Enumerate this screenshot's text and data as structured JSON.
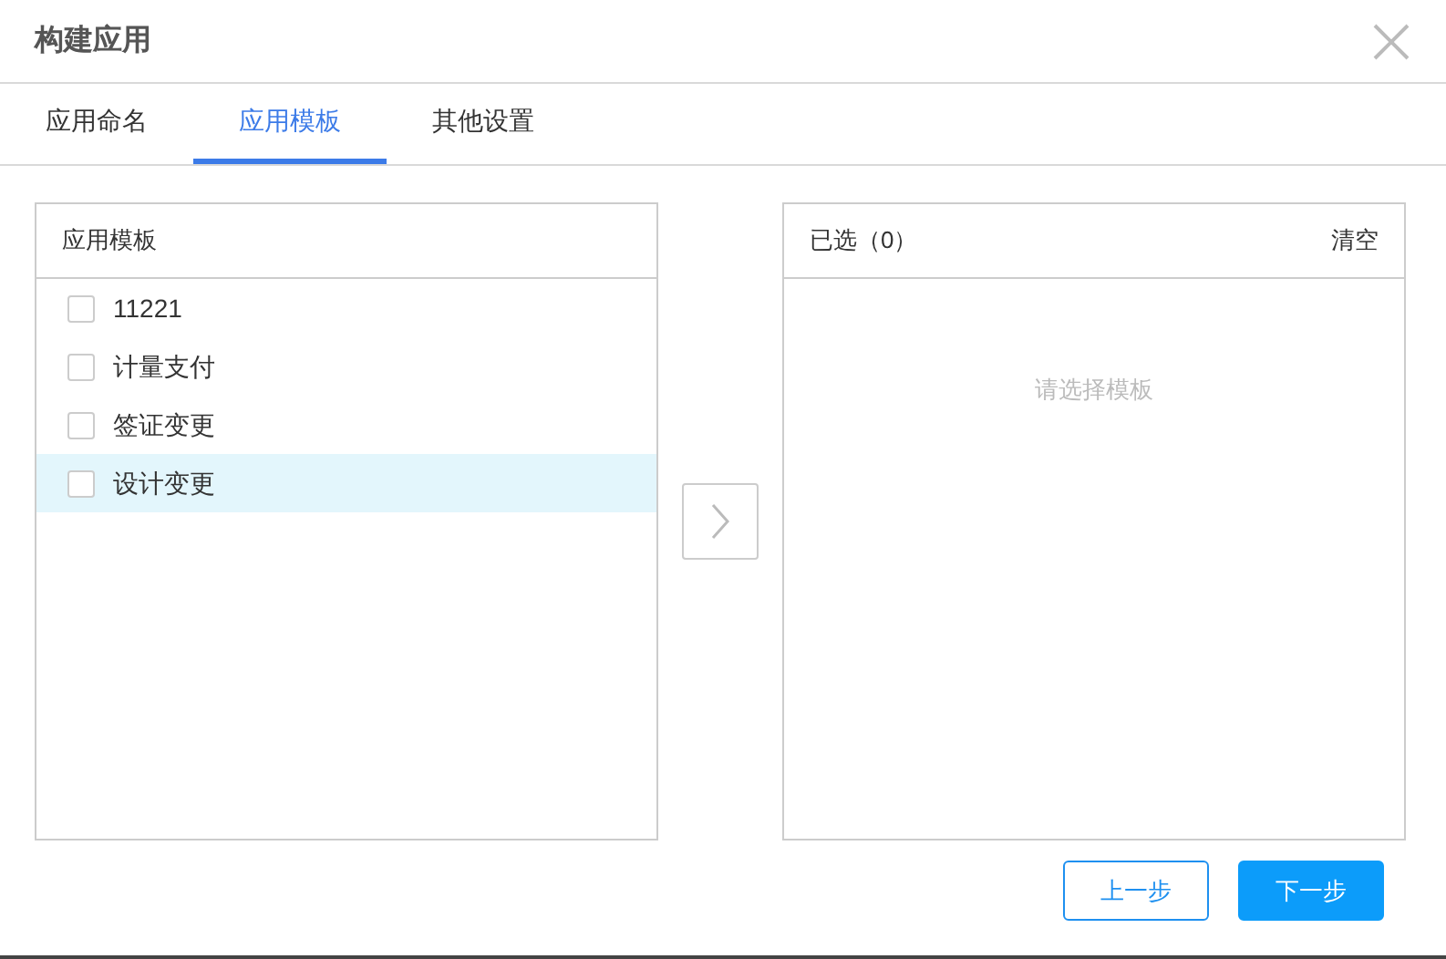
{
  "dialog": {
    "title": "构建应用"
  },
  "tabs": [
    {
      "label": "应用命名",
      "selected": false
    },
    {
      "label": "应用模板",
      "selected": true
    },
    {
      "label": "其他设置",
      "selected": false
    }
  ],
  "source_panel": {
    "title": "应用模板",
    "items": [
      {
        "label": "11221",
        "checked": false,
        "highlighted": false
      },
      {
        "label": "计量支付",
        "checked": false,
        "highlighted": false
      },
      {
        "label": "签证变更",
        "checked": false,
        "highlighted": false
      },
      {
        "label": "设计变更",
        "checked": false,
        "highlighted": true
      }
    ]
  },
  "target_panel": {
    "title": "已选（0）",
    "clear": "清空",
    "empty_text": "请选择模板"
  },
  "buttons": [
    {
      "label": "上一步",
      "kind": "secondary"
    },
    {
      "label": "下一步",
      "kind": "primary"
    }
  ]
}
